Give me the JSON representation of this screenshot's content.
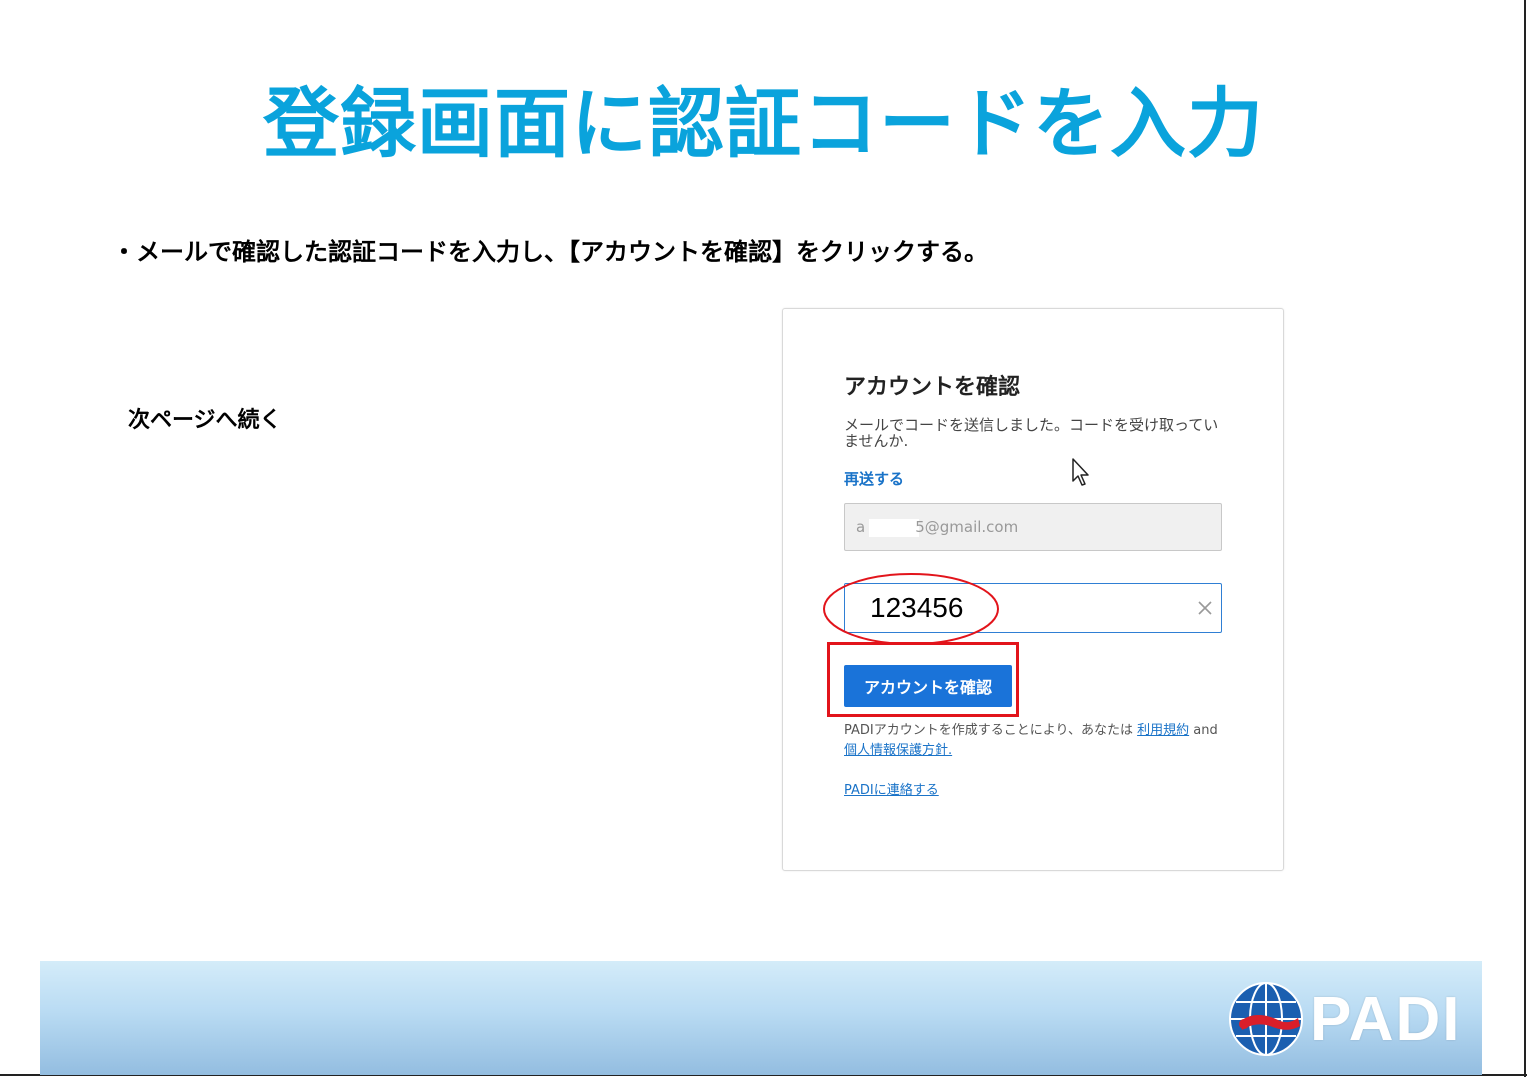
{
  "slide": {
    "title": "登録画面に認証コードを入力",
    "instruction": "・メールで確認した認証コードを入力し、【アカウントを確認】をクリックする。",
    "continue_note": "次ページへ続く"
  },
  "card": {
    "title": "アカウントを確認",
    "description": "メールでコードを送信しました。コードを受け取っていませんか.",
    "resend_link": "再送する",
    "email_prefix": "a",
    "email_suffix": "5@gmail.com",
    "code_value": "123456",
    "confirm_button": "アカウントを確認",
    "terms_text": "PADIアカウントを作成することにより、あなたは ",
    "terms_link": "利用規約",
    "terms_and": " and ",
    "privacy_link": "個人情報保護方針.",
    "contact_link": "PADIに連絡する"
  },
  "footer": {
    "logo_text": "PADI"
  },
  "colors": {
    "title": "#0aa3dc",
    "link": "#1a73c8",
    "button": "#1a73d9",
    "highlight": "#e2141b"
  },
  "icons": [
    "cursor-arrow-icon",
    "clear-icon",
    "globe-diver-icon"
  ]
}
